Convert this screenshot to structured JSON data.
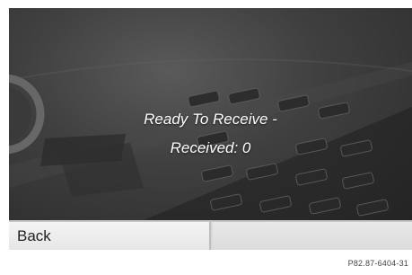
{
  "status": {
    "line1": "Ready To Receive -",
    "line2": "Received: 0"
  },
  "softkeys": {
    "left_label": "Back",
    "right_label": ""
  },
  "footer": {
    "image_code": "P82.87-6404-31"
  }
}
